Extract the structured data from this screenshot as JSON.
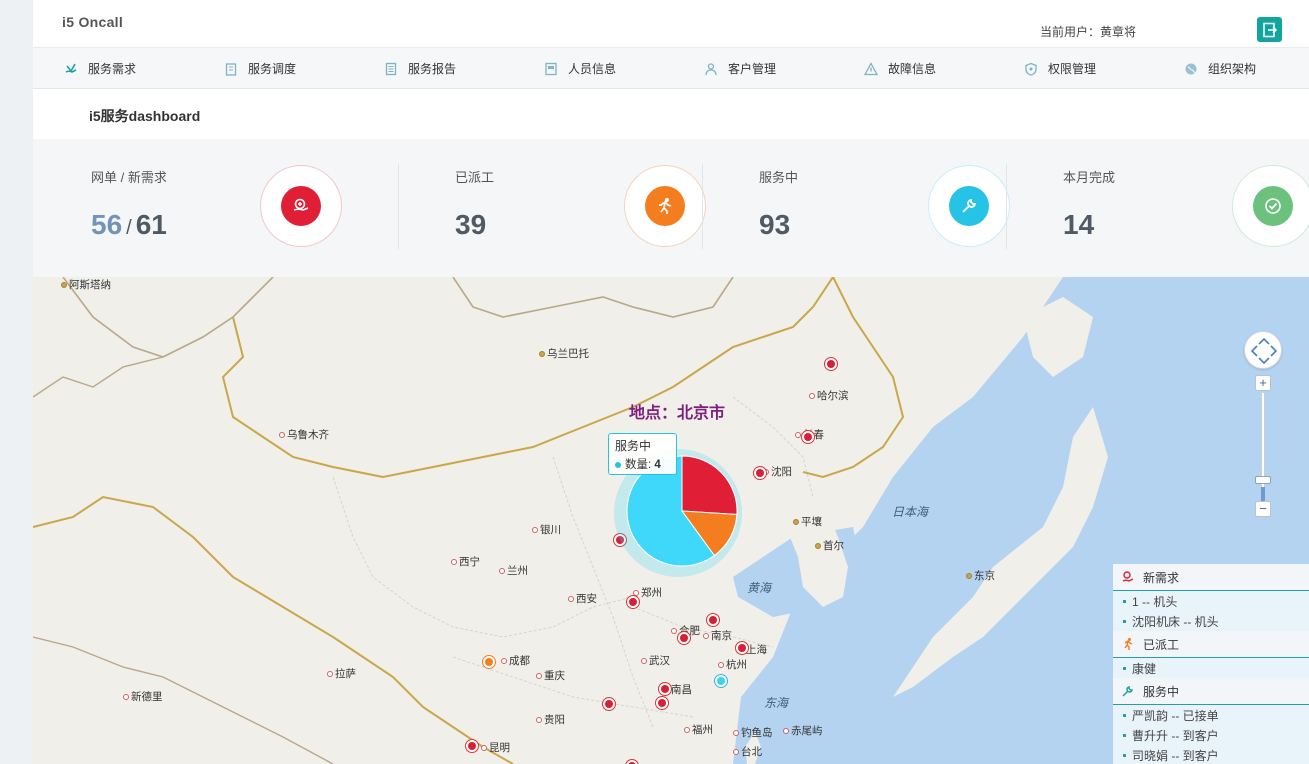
{
  "header": {
    "app_title": "i5 Oncall",
    "current_user": "当前用户：黄章将"
  },
  "nav": {
    "items": [
      {
        "label": "服务需求",
        "icon": "hand-icon"
      },
      {
        "label": "服务调度",
        "icon": "clipboard-icon"
      },
      {
        "label": "服务报告",
        "icon": "report-icon"
      },
      {
        "label": "人员信息",
        "icon": "id-card-icon"
      },
      {
        "label": "客户管理",
        "icon": "user-icon"
      },
      {
        "label": "故障信息",
        "icon": "warning-icon"
      },
      {
        "label": "权限管理",
        "icon": "shield-icon"
      },
      {
        "label": "组织架构",
        "icon": "globe-icon"
      }
    ]
  },
  "page_title": "i5服务dashboard",
  "stats": [
    {
      "label": "网单 / 新需求",
      "value_primary": "56",
      "separator": "/",
      "value": "61",
      "color": "#e01e35",
      "icon": "hand-plus-icon"
    },
    {
      "label": "已派工",
      "value": "39",
      "color": "#f47d20",
      "icon": "runner-icon"
    },
    {
      "label": "服务中",
      "value": "93",
      "color": "#27c3e6",
      "icon": "wrench-icon"
    },
    {
      "label": "本月完成",
      "value": "14",
      "color": "#6cc17d",
      "icon": "check-icon"
    }
  ],
  "map": {
    "location_label": "地点：北京市",
    "tooltip": {
      "title": "服务中",
      "series": "数量",
      "value": "4"
    },
    "pie_slices": [
      {
        "name": "新需求",
        "fraction": 0.26,
        "color": "#e01e35"
      },
      {
        "name": "已派工",
        "fraction": 0.14,
        "color": "#f47d20"
      },
      {
        "name": "服务中",
        "fraction": 0.6,
        "color": "#3fd8fb"
      }
    ],
    "cities": [
      "阿斯塔纳",
      "乌兰巴托",
      "乌鲁木齐",
      "哈尔滨",
      "长春",
      "沈阳",
      "平壤",
      "首尔",
      "银川",
      "西宁",
      "兰州",
      "西安",
      "郑州",
      "合肥",
      "南京",
      "上海",
      "武汉",
      "杭州",
      "成都",
      "重庆",
      "拉萨",
      "新德里",
      "南昌",
      "贵阳",
      "福州",
      "昆明",
      "台北",
      "钓鱼岛",
      "赤尾屿",
      "东京"
    ],
    "seas": [
      "日本海",
      "黄海",
      "东海"
    ]
  },
  "legend": {
    "groups": [
      {
        "title": "新需求",
        "icon": "hand-plus-icon",
        "color": "#e01e35",
        "items": [
          "1 -- 机头",
          "沈阳机床 -- 机头"
        ]
      },
      {
        "title": "已派工",
        "icon": "runner-icon",
        "color": "#f47d20",
        "items": [
          "康健"
        ]
      },
      {
        "title": "服务中",
        "icon": "wrench-icon",
        "color": "#1fa2a0",
        "items": [
          "严凯韵 -- 已接单",
          "曹升升 -- 到客户",
          "司晓娟 -- 到客户"
        ]
      }
    ]
  }
}
